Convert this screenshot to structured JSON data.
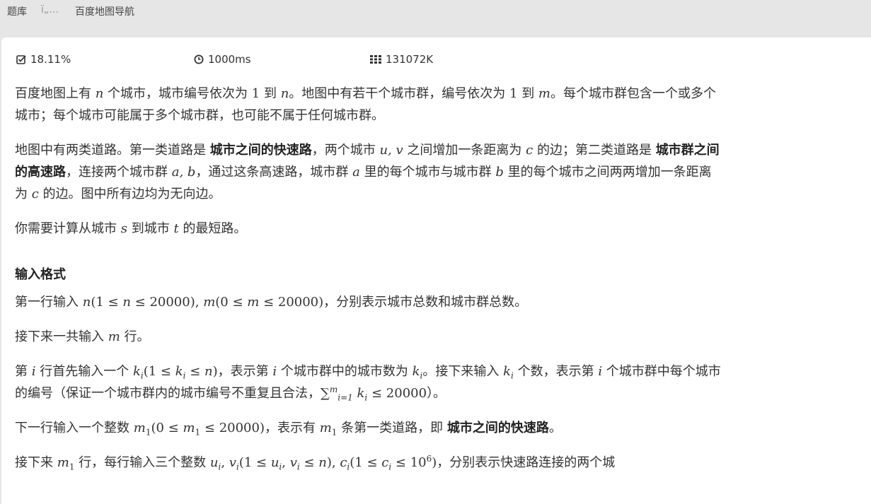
{
  "topbar": {
    "crumb1": "题库",
    "crumb2": "ï„…",
    "crumb3": "百度地图导航"
  },
  "stats": {
    "accept_rate": "18.11%",
    "time_limit": "1000ms",
    "memory_limit": "131072K"
  },
  "icons": {
    "accept": "check-square-icon",
    "time": "clock-icon",
    "memory": "grid-icon"
  },
  "problem": {
    "p1a": "百度地图上有 ",
    "p1n": "n",
    "p1b": " 个城市，城市编号依次为 ",
    "p1one": "1",
    "p1c": " 到 ",
    "p1n2": "n",
    "p1d": "。地图中有若干个城市群，编号依次为 ",
    "p1one2": "1",
    "p1e": " 到 ",
    "p1m": "m",
    "p1f": "。每个城市群包含一个或多个城市；每个城市可能属于多个城市群，也可能不属于任何城市群。",
    "p2a": "地图中有两类道路。第一类道路是 ",
    "p2b1": "城市之间的快速路",
    "p2b": "，两个城市 ",
    "p2uv": "u, v",
    "p2c": " 之间增加一条距离为 ",
    "p2cc": "c",
    "p2d": " 的边；第二类道路是 ",
    "p2b2": "城市群之间的高速路",
    "p2e": "，连接两个城市群 ",
    "p2ab": "a, b",
    "p2f": "，通过这条高速路，城市群 ",
    "p2a2": "a",
    "p2g": " 里的每个城市与城市群 ",
    "p2b3": "b",
    "p2h": " 里的每个城市之间两两增加一条距离为 ",
    "p2c2": "c",
    "p2i": " 的边。图中所有边均为无向边。",
    "p3a": "你需要计算从城市 ",
    "p3s": "s",
    "p3b": " 到城市 ",
    "p3t": "t",
    "p3c": " 的最短路。",
    "h_input": "输入格式",
    "q1a": "第一行输入 ",
    "q1n": "n",
    "q1r": "(1 ≤ ",
    "q1n2": "n",
    "q1r2": " ≤ 20000), ",
    "q1m": "m",
    "q1r3": "(0 ≤ ",
    "q1m2": "m",
    "q1r4": " ≤ 20000)",
    "q1b": "，分别表示城市总数和城市群总数。",
    "q2a": "接下来一共输入 ",
    "q2m": "m",
    "q2b": " 行。",
    "q3a": "第 ",
    "q3i": "i",
    "q3b": " 行首先输入一个 ",
    "q3k": "k",
    "q3ksub": "i",
    "q3r": "(1 ≤ ",
    "q3k2": "k",
    "q3k2sub": "i",
    "q3r2": " ≤ ",
    "q3n": "n",
    "q3r3": ")",
    "q3c": "，表示第 ",
    "q3i2": "i",
    "q3d": " 个城市群中的城市数为 ",
    "q3k3": "k",
    "q3k3sub": "i",
    "q3e": "。接下来输入 ",
    "q3k4": "k",
    "q3k4sub": "i",
    "q3f": " 个数，表示第 ",
    "q3i3": "i",
    "q3g": " 个城市群中每个城市的编号（保证一个城市群内的城市编号不重复且合法，",
    "q3sum": "∑",
    "q3sumsup": "m",
    "q3sumsub": "i=1",
    "q3k5": " k",
    "q3k5sub": "i",
    "q3r4": " ≤ 20000",
    "q3h": "）。",
    "q4a": "下一行输入一个整数 ",
    "q4m": "m",
    "q4msub": "1",
    "q4r": "(0 ≤ ",
    "q4m2": "m",
    "q4m2sub": "1",
    "q4r2": " ≤ 20000)",
    "q4b": "，表示有 ",
    "q4m3": "m",
    "q4m3sub": "1",
    "q4c": " 条第一类道路，即 ",
    "q4bold": "城市之间的快速路",
    "q4d": "。",
    "q5a": "接下来 ",
    "q5m": "m",
    "q5msub": "1",
    "q5b": " 行，每行输入三个整数 ",
    "q5u": "u",
    "q5usub": "i",
    "q5comma": ", ",
    "q5v": "v",
    "q5vsub": "i",
    "q5r": "(1 ≤ ",
    "q5u2": "u",
    "q5u2sub": "i",
    "q5comma2": ", ",
    "q5v2": "v",
    "q5v2sub": "i",
    "q5r2": " ≤ ",
    "q5n": "n",
    "q5r3": "), ",
    "q5c": "c",
    "q5csub": "i",
    "q5r4": "(1 ≤ ",
    "q5c2": "c",
    "q5c2sub": "i",
    "q5r5": " ≤ 10",
    "q5sup": "6",
    "q5r6": ")",
    "q5d": "，分别表示快速路连接的两个城"
  }
}
